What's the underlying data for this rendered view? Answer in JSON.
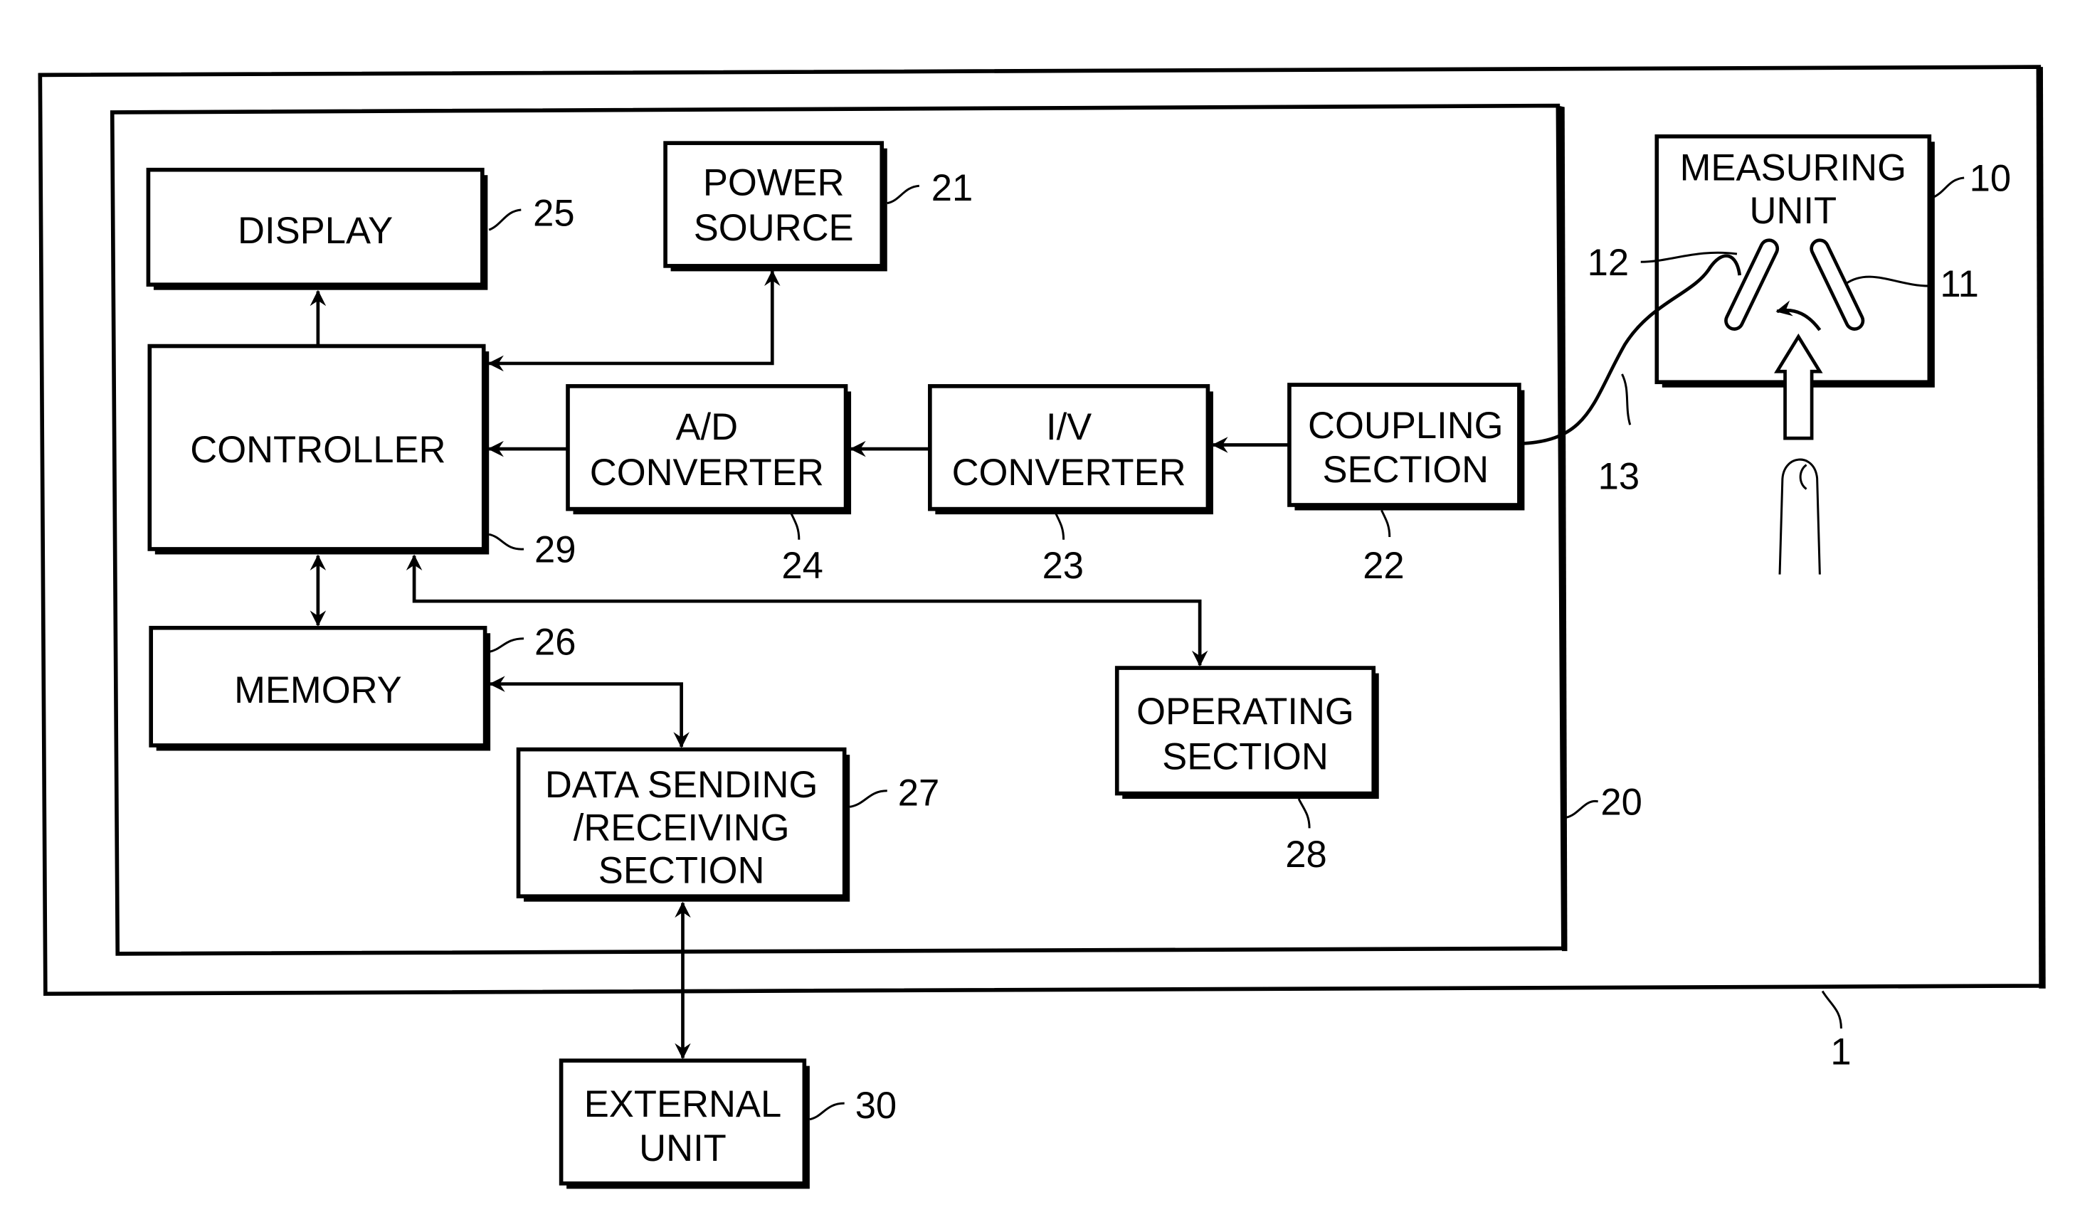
{
  "diagram": {
    "blocks": {
      "display": {
        "lines": [
          "DISPLAY"
        ],
        "ref": "25"
      },
      "power": {
        "lines": [
          "POWER",
          "SOURCE"
        ],
        "ref": "21"
      },
      "controller": {
        "lines": [
          "CONTROLLER"
        ],
        "ref": "29"
      },
      "ad": {
        "lines": [
          "A/D",
          "CONVERTER"
        ],
        "ref": "24"
      },
      "iv": {
        "lines": [
          "I/V",
          "CONVERTER"
        ],
        "ref": "23"
      },
      "coupling": {
        "lines": [
          "COUPLING",
          "SECTION"
        ],
        "ref": "22"
      },
      "memory": {
        "lines": [
          "MEMORY"
        ],
        "ref": "26"
      },
      "datasend": {
        "lines": [
          "DATA SENDING",
          "/RECEIVING",
          "SECTION"
        ],
        "ref": "27"
      },
      "operating": {
        "lines": [
          "OPERATING",
          "SECTION"
        ],
        "ref": "28"
      },
      "measuring": {
        "lines": [
          "MEASURING",
          "UNIT"
        ],
        "ref": "10"
      },
      "external": {
        "lines": [
          "EXTERNAL",
          "UNIT"
        ],
        "ref": "30"
      }
    },
    "refs": {
      "outer": "1",
      "inner": "20",
      "electrode11": "11",
      "electrode12": "12",
      "cable": "13"
    }
  }
}
